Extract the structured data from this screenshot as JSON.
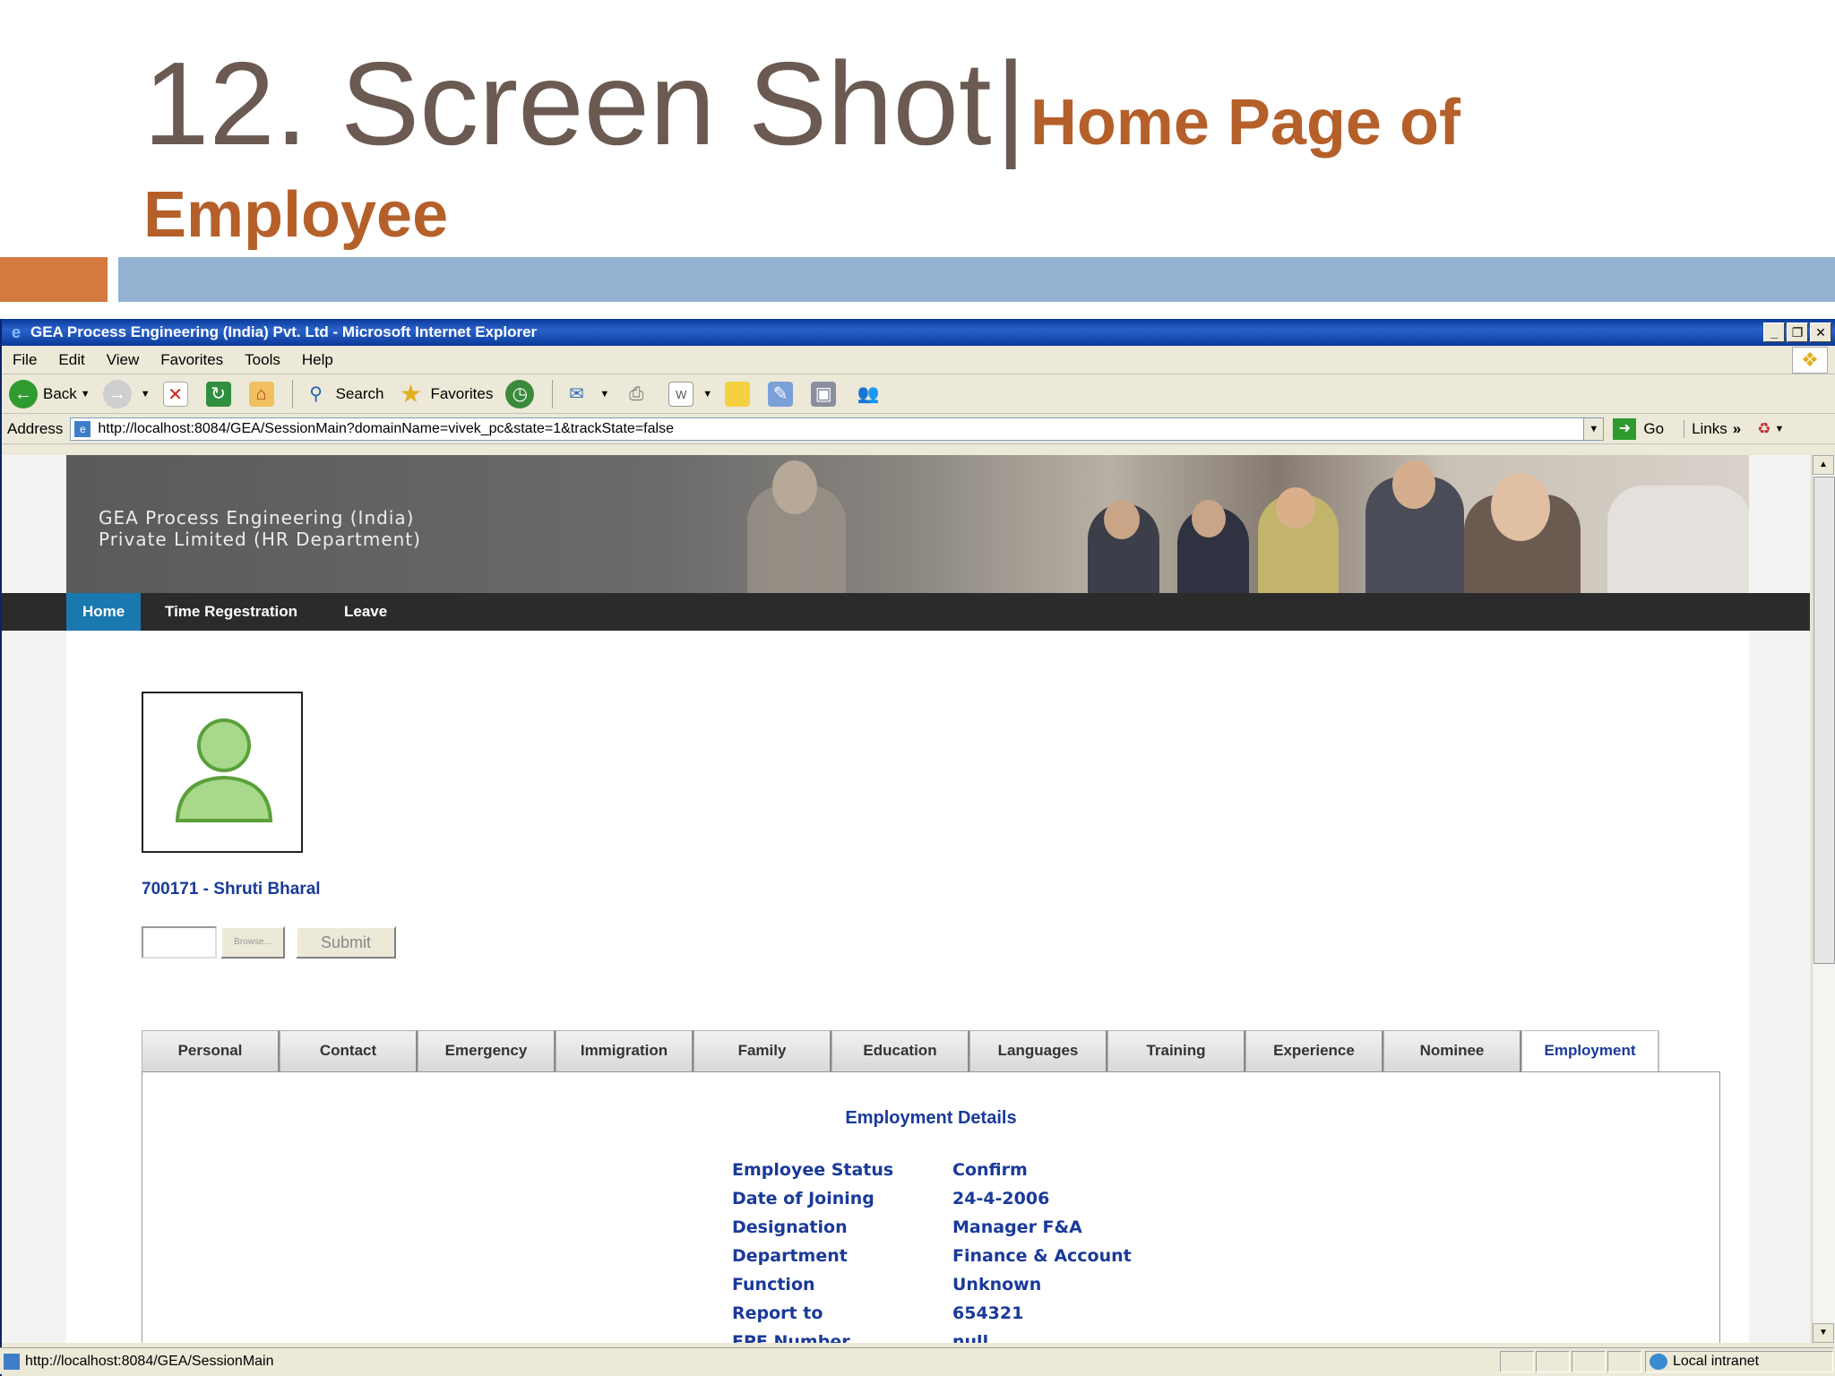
{
  "slide": {
    "title_main": "12. Screen Shot",
    "title_sep": "|",
    "title_sub1": "Home Page of",
    "title_sub2": "Employee"
  },
  "window": {
    "title": "GEA Process Engineering (India) Pvt. Ltd - Microsoft Internet Explorer",
    "buttons": [
      "_",
      "❐",
      "✕"
    ]
  },
  "menu": [
    "File",
    "Edit",
    "View",
    "Favorites",
    "Tools",
    "Help"
  ],
  "toolbar": {
    "back_label": "Back",
    "search_label": "Search",
    "favorites_label": "Favorites"
  },
  "address": {
    "label": "Address",
    "url": "http://localhost:8084/GEA/SessionMain?domainName=vivek_pc&state=1&trackState=false",
    "go_label": "Go",
    "links_label": "Links"
  },
  "site": {
    "company_line1": "GEA Process Engineering (India)",
    "company_line2": "Private Limited (HR Department)",
    "nav": [
      "Home",
      "Time Regestration",
      "Leave"
    ]
  },
  "employee": {
    "id_name": "700171 - Shruti Bharal",
    "browse_label": "Browse...",
    "submit_label": "Submit"
  },
  "tabs": [
    "Personal",
    "Contact",
    "Emergency",
    "Immigration",
    "Family",
    "Education",
    "Languages",
    "Training",
    "Experience",
    "Nominee",
    "Employment"
  ],
  "active_tab": "Employment",
  "employment": {
    "section_title": "Employment Details",
    "rows": [
      {
        "label": "Employee Status",
        "value": "Confirm"
      },
      {
        "label": "Date of Joining",
        "value": "24-4-2006"
      },
      {
        "label": "Designation",
        "value": "Manager F&A"
      },
      {
        "label": "Department",
        "value": "Finance & Account"
      },
      {
        "label": "Function",
        "value": "Unknown"
      },
      {
        "label": "Report to",
        "value": "654321"
      },
      {
        "label": "EPF Number",
        "value": "null"
      }
    ]
  },
  "status": {
    "url": "http://localhost:8084/GEA/SessionMain",
    "zone": "Local intranet"
  },
  "colors": {
    "title_gray": "#6b5a52",
    "title_orange": "#b5602a",
    "band_orange": "#d47a3f",
    "band_blue": "#94b3d3",
    "nav_active": "#1a78b0",
    "detail_text": "#1a3a9a"
  }
}
